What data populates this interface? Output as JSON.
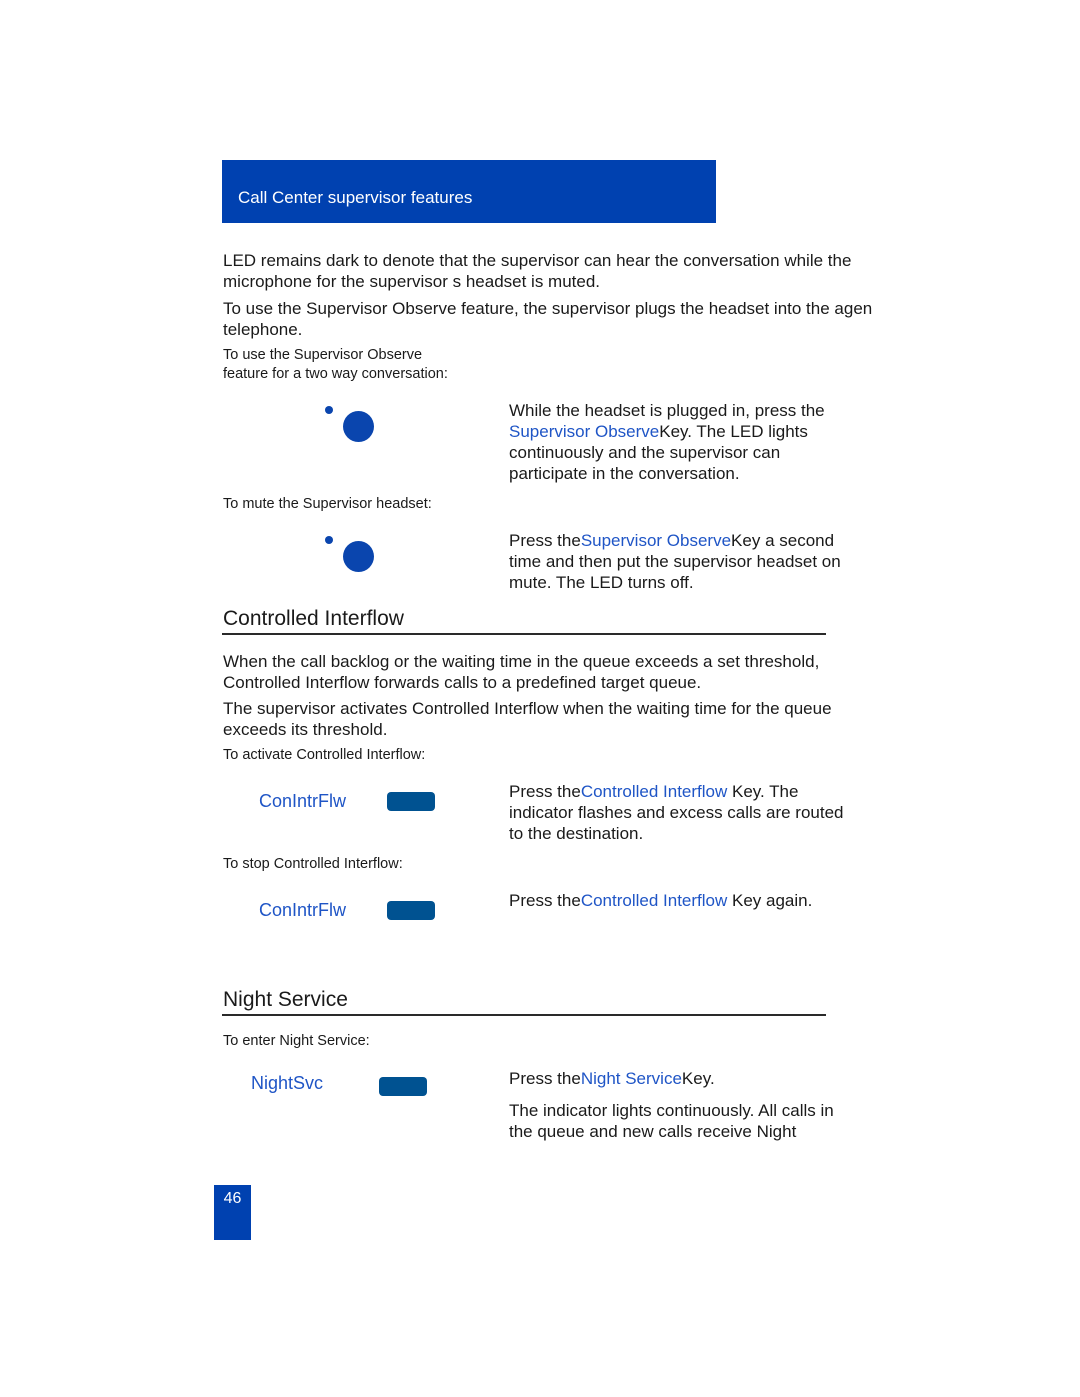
{
  "header": {
    "title": "Call Center supervisor features"
  },
  "intro": {
    "para1_line1": "LED remains dark to denote that the supervisor can hear the conversation while the",
    "para1_line2": "microphone for the supervisor s headset is muted.",
    "para2_line1": "To use the Supervisor Observe feature, the supervisor plugs the headset into the agen",
    "para2_line2": "telephone."
  },
  "supervisor_observe": {
    "two_way": {
      "label_line1": "To use the Supervisor Observe",
      "label_line2": "feature for a two way conversation:",
      "desc_line1": "While the headset is plugged in, press the",
      "desc_link": "Supervisor Observe",
      "desc_line2_rest": "Key. The LED lights",
      "desc_line3": "continuously and the supervisor can",
      "desc_line4": "participate in the conversation."
    },
    "mute": {
      "label": "To mute the Supervisor headset:",
      "desc_prefix": "Press the",
      "desc_link": "Supervisor Observe",
      "desc_line1_rest": "Key a second",
      "desc_line2": "time and then put the supervisor headset on",
      "desc_line3": "mute. The LED turns off."
    }
  },
  "controlled_interflow": {
    "title": "Controlled Interflow",
    "para1_line1": "When the call backlog or the waiting time in the queue exceeds a set threshold,",
    "para1_line2": "Controlled Interflow forwards calls to a predefined target queue.",
    "para2_line1": "The supervisor activates Controlled Interflow when the waiting time for the queue",
    "para2_line2": "exceeds its threshold.",
    "activate": {
      "label": "To activate Controlled Interflow:",
      "key_label": "ConIntrFlw",
      "desc_prefix": "Press the",
      "desc_link": "Controlled Interflow",
      "desc_line1_rest": " Key. The",
      "desc_line2": "indicator flashes and excess calls are routed",
      "desc_line3": "to the destination."
    },
    "stop": {
      "label": "To stop Controlled Interflow:",
      "key_label": "ConIntrFlw",
      "desc_prefix": "Press the",
      "desc_link": "Controlled Interflow",
      "desc_rest": " Key again."
    }
  },
  "night_service": {
    "title": "Night Service",
    "enter": {
      "label": "To enter Night Service:",
      "key_label": "NightSvc",
      "desc_prefix": "Press the",
      "desc_link": "Night Service",
      "desc_rest": "Key.",
      "desc2_line1": "The indicator lights continuously. All calls in",
      "desc2_line2": "the queue and new calls receive Night"
    }
  },
  "footer": {
    "page_number": "46"
  }
}
